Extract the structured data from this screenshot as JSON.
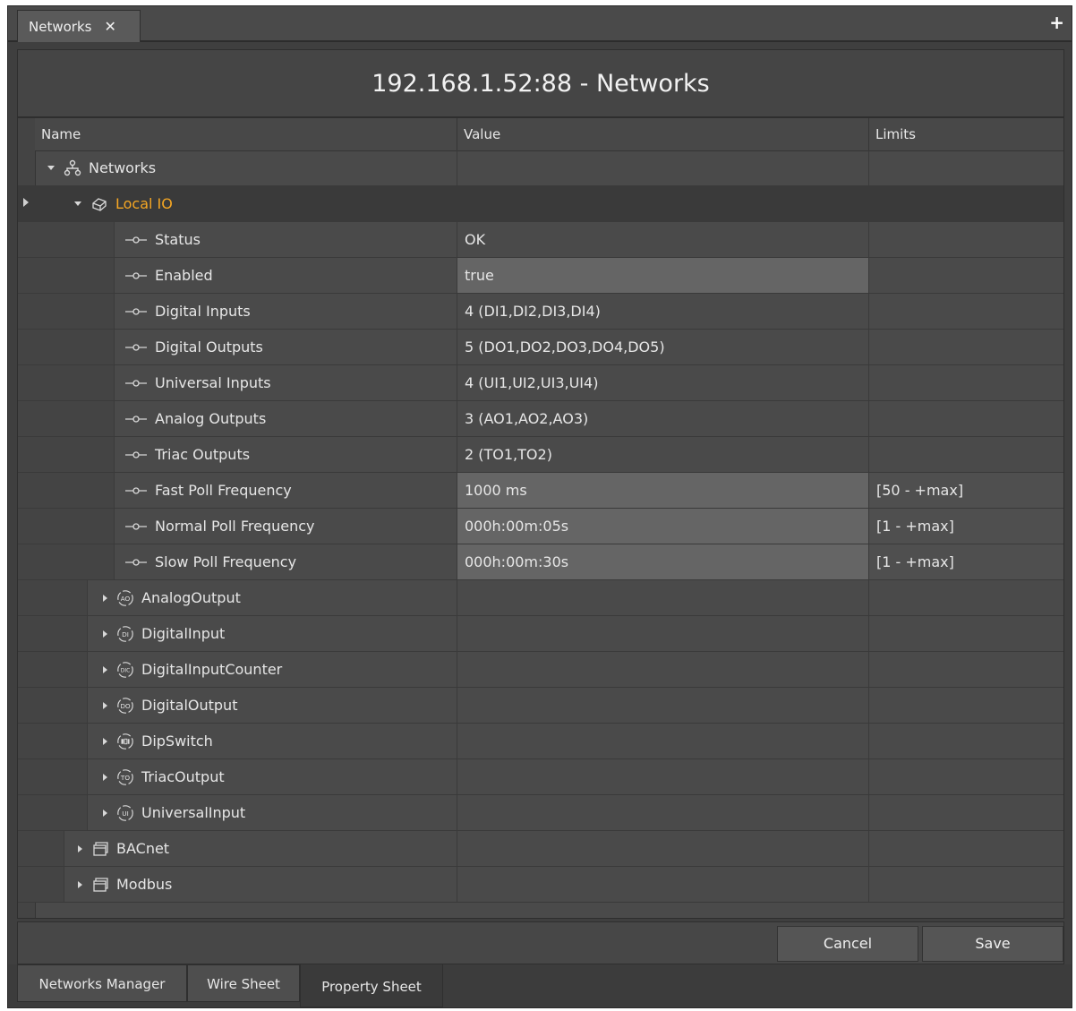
{
  "document_tab": {
    "label": "Networks",
    "close_glyph": "✕"
  },
  "add_glyph": "+",
  "title": "192.168.1.52:88 - Networks",
  "columns": {
    "name": "Name",
    "value": "Value",
    "limits": "Limits"
  },
  "rows": [
    {
      "label": "Networks",
      "value": "",
      "limits": ""
    },
    {
      "label": "Local IO",
      "value": "",
      "limits": ""
    },
    {
      "label": "Status",
      "value": "OK",
      "limits": ""
    },
    {
      "label": "Enabled",
      "value": "true",
      "limits": ""
    },
    {
      "label": "Digital Inputs",
      "value": "4 (DI1,DI2,DI3,DI4)",
      "limits": ""
    },
    {
      "label": "Digital Outputs",
      "value": "5 (DO1,DO2,DO3,DO4,DO5)",
      "limits": ""
    },
    {
      "label": "Universal Inputs",
      "value": "4 (UI1,UI2,UI3,UI4)",
      "limits": ""
    },
    {
      "label": "Analog Outputs",
      "value": "3 (AO1,AO2,AO3)",
      "limits": ""
    },
    {
      "label": "Triac Outputs",
      "value": "2 (TO1,TO2)",
      "limits": ""
    },
    {
      "label": "Fast Poll Frequency",
      "value": "1000 ms",
      "limits": "[50 - +max]"
    },
    {
      "label": "Normal Poll Frequency",
      "value": "000h:00m:05s",
      "limits": "[1 - +max]"
    },
    {
      "label": "Slow Poll Frequency",
      "value": "000h:00m:30s",
      "limits": "[1 - +max]"
    },
    {
      "label": "AnalogOutput",
      "icon_text": "AO",
      "value": "",
      "limits": ""
    },
    {
      "label": "DigitalInput",
      "icon_text": "DI",
      "value": "",
      "limits": ""
    },
    {
      "label": "DigitalInputCounter",
      "icon_text": "DIC",
      "value": "",
      "limits": ""
    },
    {
      "label": "DigitalOutput",
      "icon_text": "DO",
      "value": "",
      "limits": ""
    },
    {
      "label": "DipSwitch",
      "icon_text": "",
      "value": "",
      "limits": ""
    },
    {
      "label": "TriacOutput",
      "icon_text": "TO",
      "value": "",
      "limits": ""
    },
    {
      "label": "UniversalInput",
      "icon_text": "UI",
      "value": "",
      "limits": ""
    },
    {
      "label": "BACnet",
      "value": "",
      "limits": ""
    },
    {
      "label": "Modbus",
      "value": "",
      "limits": ""
    }
  ],
  "buttons": {
    "cancel": "Cancel",
    "save": "Save"
  },
  "bottom_tabs": [
    {
      "label": "Networks Manager"
    },
    {
      "label": "Wire Sheet"
    },
    {
      "label": "Property Sheet",
      "active": true
    }
  ],
  "colors": {
    "selected_label": "#f5a623",
    "editable_value_bg": "#656565"
  }
}
